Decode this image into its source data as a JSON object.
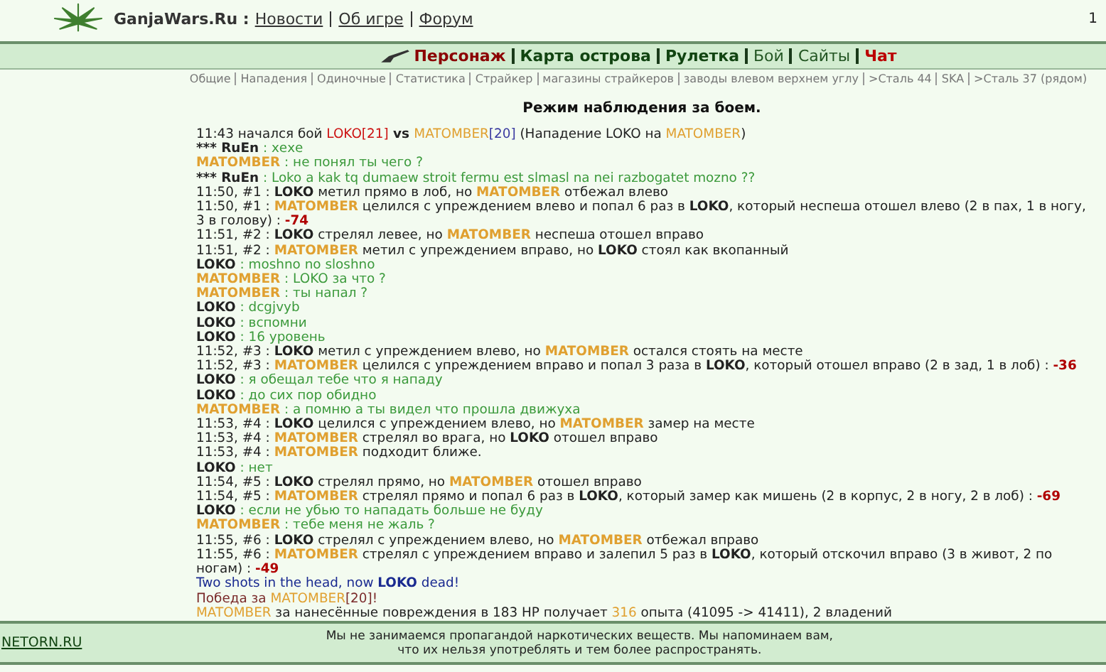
{
  "header": {
    "site": "GanjaWars.Ru :",
    "links": [
      "Новости",
      "Об игре",
      "Форум"
    ],
    "counter": "1"
  },
  "nav": [
    {
      "label": "Персонаж",
      "kind": "bold",
      "selected": true
    },
    {
      "label": "Карта острова",
      "kind": "bold",
      "selected": false
    },
    {
      "label": "Рулетка",
      "kind": "bold",
      "selected": false
    },
    {
      "label": "Бой",
      "kind": "plain",
      "selected": false
    },
    {
      "label": "Сайты",
      "kind": "plain",
      "selected": false
    },
    {
      "label": "Чат",
      "kind": "alert",
      "selected": false
    }
  ],
  "subnav": [
    "Общие",
    "Нападения",
    "Одиночные",
    "Статистика",
    "Страйкер",
    "магазины страйкеров",
    "заводы влевом верхнем углу",
    ">Сталь 44",
    "SKA",
    ">Сталь 37 (рядом)"
  ],
  "title": "Режим наблюдения за боем.",
  "log": [
    [
      {
        "kind": "text",
        "text": "11:43 начался бой "
      },
      {
        "kind": "red",
        "text": "LOKO[21]"
      },
      {
        "kind": "bold",
        "text": " vs "
      },
      {
        "kind": "orange",
        "text": "MATOMBER"
      },
      {
        "kind": "level",
        "text": "[20]"
      },
      {
        "kind": "text",
        "text": " (Нападение LOKO на "
      },
      {
        "kind": "orange",
        "text": "MATOMBER"
      },
      {
        "kind": "text",
        "text": ")"
      }
    ],
    [
      {
        "kind": "bold",
        "text": "*** RuEn"
      },
      {
        "kind": "chat",
        "text": " : хехе"
      }
    ],
    [
      {
        "kind": "orange-bold",
        "text": "MATOMBER"
      },
      {
        "kind": "chat",
        "text": " : не понял ты чего ?"
      }
    ],
    [
      {
        "kind": "bold",
        "text": "*** RuEn"
      },
      {
        "kind": "chat",
        "text": " : Loko a kak tq dumaew stroit fermu est slmasl na nei razbogatet mozno ??"
      }
    ],
    [
      {
        "kind": "text",
        "text": "11:50, #1 : "
      },
      {
        "kind": "bold",
        "text": "LOKO"
      },
      {
        "kind": "text",
        "text": " метил прямо в лоб, но "
      },
      {
        "kind": "orange-bold",
        "text": "MATOMBER"
      },
      {
        "kind": "text",
        "text": " отбежал влево"
      }
    ],
    [
      {
        "kind": "text",
        "text": "11:50, #1 : "
      },
      {
        "kind": "orange-bold",
        "text": "MATOMBER"
      },
      {
        "kind": "text",
        "text": " целился с упреждением влево и попал 6 раз в "
      },
      {
        "kind": "bold",
        "text": "LOKO"
      },
      {
        "kind": "text",
        "text": ", который неспеша отошел влево (2 в пах, 1 в ногу, 3 в голову) : "
      },
      {
        "kind": "damage",
        "text": "-74"
      }
    ],
    [
      {
        "kind": "text",
        "text": "11:51, #2 : "
      },
      {
        "kind": "bold",
        "text": "LOKO"
      },
      {
        "kind": "text",
        "text": " стрелял левее, но "
      },
      {
        "kind": "orange-bold",
        "text": "MATOMBER"
      },
      {
        "kind": "text",
        "text": " неспеша отошел вправо"
      }
    ],
    [
      {
        "kind": "text",
        "text": "11:51, #2 : "
      },
      {
        "kind": "orange-bold",
        "text": "MATOMBER"
      },
      {
        "kind": "text",
        "text": " метил с упреждением вправо, но "
      },
      {
        "kind": "bold",
        "text": "LOKO"
      },
      {
        "kind": "text",
        "text": " стоял как вкопанный"
      }
    ],
    [
      {
        "kind": "bold",
        "text": "LOKO"
      },
      {
        "kind": "chat",
        "text": " : moshno no sloshno"
      }
    ],
    [
      {
        "kind": "orange-bold",
        "text": "MATOMBER"
      },
      {
        "kind": "chat",
        "text": " : LOKO за что ?"
      }
    ],
    [
      {
        "kind": "orange-bold",
        "text": "MATOMBER"
      },
      {
        "kind": "chat",
        "text": " : ты напал ?"
      }
    ],
    [
      {
        "kind": "bold",
        "text": "LOKO"
      },
      {
        "kind": "chat",
        "text": " : dcgjvyb"
      }
    ],
    [
      {
        "kind": "bold",
        "text": "LOKO"
      },
      {
        "kind": "chat",
        "text": " : вспомни"
      }
    ],
    [
      {
        "kind": "bold",
        "text": "LOKO"
      },
      {
        "kind": "chat",
        "text": " : 16 уровень"
      }
    ],
    [
      {
        "kind": "text",
        "text": "11:52, #3 : "
      },
      {
        "kind": "bold",
        "text": "LOKO"
      },
      {
        "kind": "text",
        "text": " метил с упреждением влево, но "
      },
      {
        "kind": "orange-bold",
        "text": "MATOMBER"
      },
      {
        "kind": "text",
        "text": " остался стоять на месте"
      }
    ],
    [
      {
        "kind": "text",
        "text": "11:52, #3 : "
      },
      {
        "kind": "orange-bold",
        "text": "MATOMBER"
      },
      {
        "kind": "text",
        "text": " целился с упреждением вправо и попал 3 раза в "
      },
      {
        "kind": "bold",
        "text": "LOKO"
      },
      {
        "kind": "text",
        "text": ", который отошел вправо (2 в зад, 1 в лоб) : "
      },
      {
        "kind": "damage",
        "text": "-36"
      }
    ],
    [
      {
        "kind": "bold",
        "text": "LOKO"
      },
      {
        "kind": "chat",
        "text": " : я обещал тебе что я нападу"
      }
    ],
    [
      {
        "kind": "bold",
        "text": "LOKO"
      },
      {
        "kind": "chat",
        "text": " : до сих пор обидно"
      }
    ],
    [
      {
        "kind": "orange-bold",
        "text": "MATOMBER"
      },
      {
        "kind": "chat",
        "text": " : а помню а ты видел что прошла движуха"
      }
    ],
    [
      {
        "kind": "text",
        "text": "11:53, #4 : "
      },
      {
        "kind": "bold",
        "text": "LOKO"
      },
      {
        "kind": "text",
        "text": " целился с упреждением влево, но "
      },
      {
        "kind": "orange-bold",
        "text": "MATOMBER"
      },
      {
        "kind": "text",
        "text": " замер на месте"
      }
    ],
    [
      {
        "kind": "text",
        "text": "11:53, #4 : "
      },
      {
        "kind": "orange-bold",
        "text": "MATOMBER"
      },
      {
        "kind": "text",
        "text": " стрелял во врага, но "
      },
      {
        "kind": "bold",
        "text": "LOKO"
      },
      {
        "kind": "text",
        "text": " отошел вправо"
      }
    ],
    [
      {
        "kind": "text",
        "text": "11:53, #4 : "
      },
      {
        "kind": "orange-bold",
        "text": "MATOMBER"
      },
      {
        "kind": "text",
        "text": " подходит ближе."
      }
    ],
    [
      {
        "kind": "bold",
        "text": "LOKO"
      },
      {
        "kind": "chat",
        "text": " : нет"
      }
    ],
    [
      {
        "kind": "text",
        "text": "11:54, #5 : "
      },
      {
        "kind": "bold",
        "text": "LOKO"
      },
      {
        "kind": "text",
        "text": " стрелял прямо, но "
      },
      {
        "kind": "orange-bold",
        "text": "MATOMBER"
      },
      {
        "kind": "text",
        "text": " отошел вправо"
      }
    ],
    [
      {
        "kind": "text",
        "text": "11:54, #5 : "
      },
      {
        "kind": "orange-bold",
        "text": "MATOMBER"
      },
      {
        "kind": "text",
        "text": " стрелял прямо и попал 6 раз в "
      },
      {
        "kind": "bold",
        "text": "LOKO"
      },
      {
        "kind": "text",
        "text": ", который замер как мишень (2 в корпус, 2 в ногу, 2 в лоб) : "
      },
      {
        "kind": "damage",
        "text": "-69"
      }
    ],
    [
      {
        "kind": "bold",
        "text": "LOKO"
      },
      {
        "kind": "chat",
        "text": " : если не убью то нападать больше не буду"
      }
    ],
    [
      {
        "kind": "orange-bold",
        "text": "MATOMBER"
      },
      {
        "kind": "chat",
        "text": " : тебе меня не жаль ?"
      }
    ],
    [
      {
        "kind": "text",
        "text": "11:55, #6 : "
      },
      {
        "kind": "bold",
        "text": "LOKO"
      },
      {
        "kind": "text",
        "text": " стрелял с упреждением влево, но "
      },
      {
        "kind": "orange-bold",
        "text": "MATOMBER"
      },
      {
        "kind": "text",
        "text": " отбежал вправо"
      }
    ],
    [
      {
        "kind": "text",
        "text": "11:55, #6 : "
      },
      {
        "kind": "orange-bold",
        "text": "MATOMBER"
      },
      {
        "kind": "text",
        "text": " стрелял с упреждением вправо и залепил 5 раз в "
      },
      {
        "kind": "bold",
        "text": "LOKO"
      },
      {
        "kind": "text",
        "text": ", который отскочил вправо (3 в живот, 2 по ногам) : "
      },
      {
        "kind": "damage",
        "text": "-49"
      }
    ],
    [
      {
        "kind": "navy",
        "text": "Two shots in the head, now "
      },
      {
        "kind": "navy-bold",
        "text": "LOKO"
      },
      {
        "kind": "navy",
        "text": " dead!"
      }
    ],
    [
      {
        "kind": "maroon",
        "text": "Победа за "
      },
      {
        "kind": "orange",
        "text": "MATOMBER"
      },
      {
        "kind": "maroon",
        "text": "[20]!"
      }
    ],
    [
      {
        "kind": "orange",
        "text": "MATOMBER"
      },
      {
        "kind": "text",
        "text": " за нанесённые повреждения в 183 HP получает "
      },
      {
        "kind": "orange",
        "text": "316"
      },
      {
        "kind": "text",
        "text": " опыта (41095 -> 41411), 2 владений"
      }
    ]
  ],
  "footer": {
    "link": "NETORN.RU",
    "notice": "Мы не занимаемся пропагандой наркотических веществ. Мы напоминаем вам, что их нельзя употреблять и тем более распространять."
  }
}
